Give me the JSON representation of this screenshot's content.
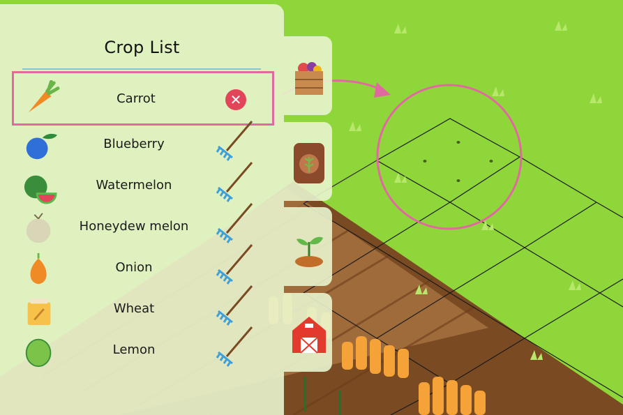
{
  "crop_list": {
    "title": "Crop List",
    "selected_remove_label": "✕",
    "items": [
      {
        "label": "Carrot",
        "icon": "carrot-icon",
        "selected": true
      },
      {
        "label": "Blueberry",
        "icon": "blueberry-icon"
      },
      {
        "label": "Watermelon",
        "icon": "watermelon-icon"
      },
      {
        "label": "Honeydew melon",
        "icon": "honeydew-melon-icon"
      },
      {
        "label": "Onion",
        "icon": "onion-icon"
      },
      {
        "label": "Wheat",
        "icon": "wheat-icon"
      },
      {
        "label": "Lemon",
        "icon": "lemon-icon"
      }
    ]
  },
  "side_tabs": [
    {
      "icon": "harvest-crate-icon"
    },
    {
      "icon": "seed-bag-icon"
    },
    {
      "icon": "sprout-soil-icon"
    },
    {
      "icon": "barn-icon"
    }
  ],
  "colors": {
    "grass": "#8fd63a",
    "highlight": "#e06aa0",
    "remove": "#e2455a",
    "panel": "#e8f4ce",
    "rule": "#7cc9d6"
  }
}
